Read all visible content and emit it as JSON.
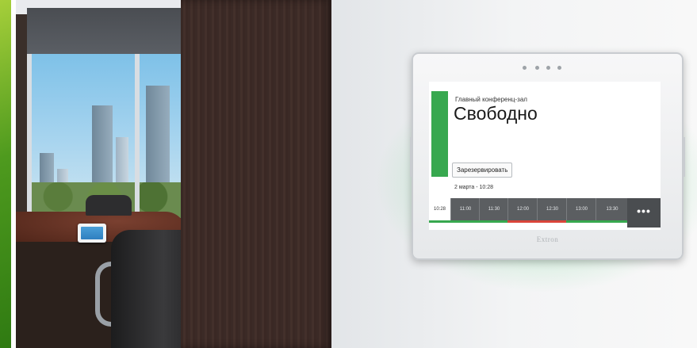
{
  "panel": {
    "room_name": "Главный конференц-зал",
    "status": "Свободно",
    "reserve_label": "Зарезервировать",
    "datetime": "2 марта - 10:28",
    "current_time": "10:28",
    "time_slots": [
      "11:00",
      "11:30",
      "12:00",
      "12:30",
      "13:00",
      "13:30"
    ],
    "more_label": "•••",
    "brand": "Extron"
  },
  "colors": {
    "status_available": "#37a84f",
    "booked": "#d9453a",
    "slot_bg": "#5b5e61",
    "wall_glow": "#50d278"
  },
  "icons": [
    "more-icon"
  ]
}
